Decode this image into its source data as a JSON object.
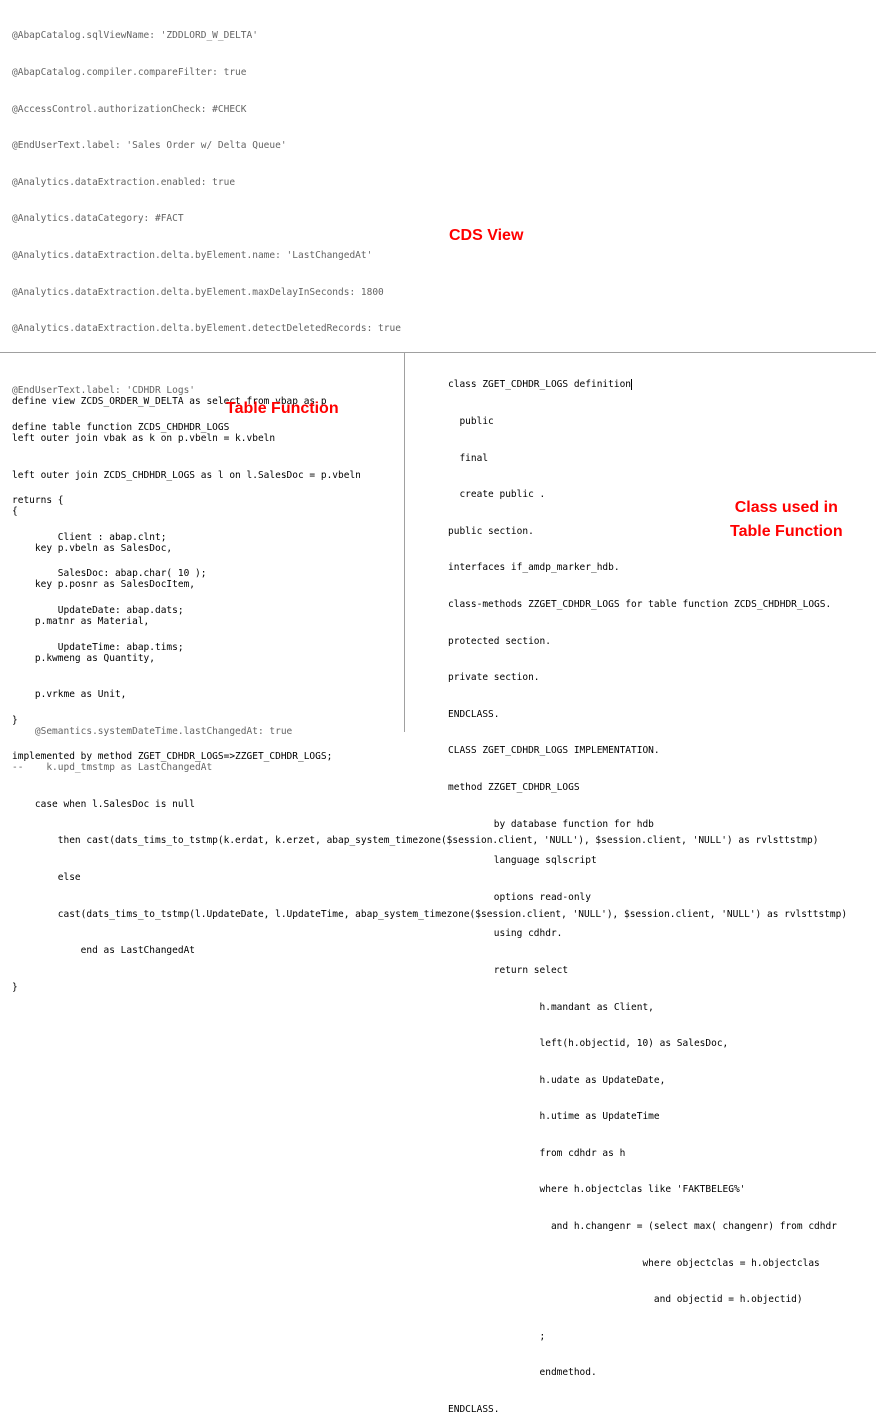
{
  "cds_view": {
    "label": "CDS View",
    "annotations": [
      "@AbapCatalog.sqlViewName: 'ZDDLORD_W_DELTA'",
      "@AbapCatalog.compiler.compareFilter: true",
      "@AccessControl.authorizationCheck: #CHECK",
      "@EndUserText.label: 'Sales Order w/ Delta Queue'",
      "@Analytics.dataExtraction.enabled: true",
      "@Analytics.dataCategory: #FACT",
      "@Analytics.dataExtraction.delta.byElement.name: 'LastChangedAt'",
      "@Analytics.dataExtraction.delta.byElement.maxDelayInSeconds: 1800",
      "@Analytics.dataExtraction.delta.byElement.detectDeletedRecords: true"
    ],
    "body": [
      "define view ZCDS_ORDER_W_DELTA as select from vbap as p",
      "left outer join vbak as k on p.vbeln = k.vbeln",
      "left outer join ZCDS_CHDHDR_LOGS as l on l.SalesDoc = p.vbeln",
      "{",
      "    key p.vbeln as SalesDoc,",
      "    key p.posnr as SalesDocItem,",
      "    p.matnr as Material,",
      "    p.kwmeng as Quantity,",
      "    p.vrkme as Unit,",
      "    @Semantics.systemDateTime.lastChangedAt: true",
      "--    k.upd_tmstmp as LastChangedAt",
      "    case when l.SalesDoc is null",
      "        then cast(dats_tims_to_tstmp(k.erdat, k.erzet, abap_system_timezone($session.client, 'NULL'), $session.client, 'NULL') as rvlsttstmp)",
      "        else",
      "        cast(dats_tims_to_tstmp(l.UpdateDate, l.UpdateTime, abap_system_timezone($session.client, 'NULL'), $session.client, 'NULL') as rvlsttstmp)",
      "            end as LastChangedAt",
      "}"
    ]
  },
  "table_function": {
    "label": "Table Function",
    "lines": [
      "@EndUserText.label: 'CDHDR Logs'",
      "define table function ZCDS_CHDHDR_LOGS",
      "",
      "returns {",
      "        Client : abap.clnt;",
      "        SalesDoc: abap.char( 10 );",
      "        UpdateDate: abap.dats;",
      "        UpdateTime: abap.tims;",
      "",
      "}",
      "implemented by method ZGET_CDHDR_LOGS=>ZZGET_CDHDR_LOGS;"
    ]
  },
  "class_code": {
    "label_line1": "Class used in",
    "label_line2": "Table Function",
    "lines": [
      "class ZGET_CDHDR_LOGS definition",
      "  public",
      "  final",
      "  create public .",
      "public section.",
      "interfaces if_amdp_marker_hdb.",
      "class-methods ZZGET_CDHDR_LOGS for table function ZCDS_CHDHDR_LOGS.",
      "protected section.",
      "private section.",
      "ENDCLASS.",
      "CLASS ZGET_CDHDR_LOGS IMPLEMENTATION.",
      "method ZZGET_CDHDR_LOGS",
      "        by database function for hdb",
      "        language sqlscript",
      "        options read-only",
      "        using cdhdr.",
      "        return select",
      "                h.mandant as Client,",
      "                left(h.objectid, 10) as SalesDoc,",
      "                h.udate as UpdateDate,",
      "                h.utime as UpdateTime",
      "                from cdhdr as h",
      "                where h.objectclas like 'FAKTBELEG%'",
      "                  and h.changenr = (select max( changenr) from cdhdr",
      "                                  where objectclas = h.objectclas",
      "                                    and objectid = h.objectid)",
      "                ;",
      "                endmethod.",
      "ENDCLASS."
    ]
  },
  "colors": {
    "keyword": "#7f0055",
    "annotation": "#646464",
    "string": "#2a00ff",
    "label": "#ff0000",
    "divider": "#a0a0a0"
  }
}
